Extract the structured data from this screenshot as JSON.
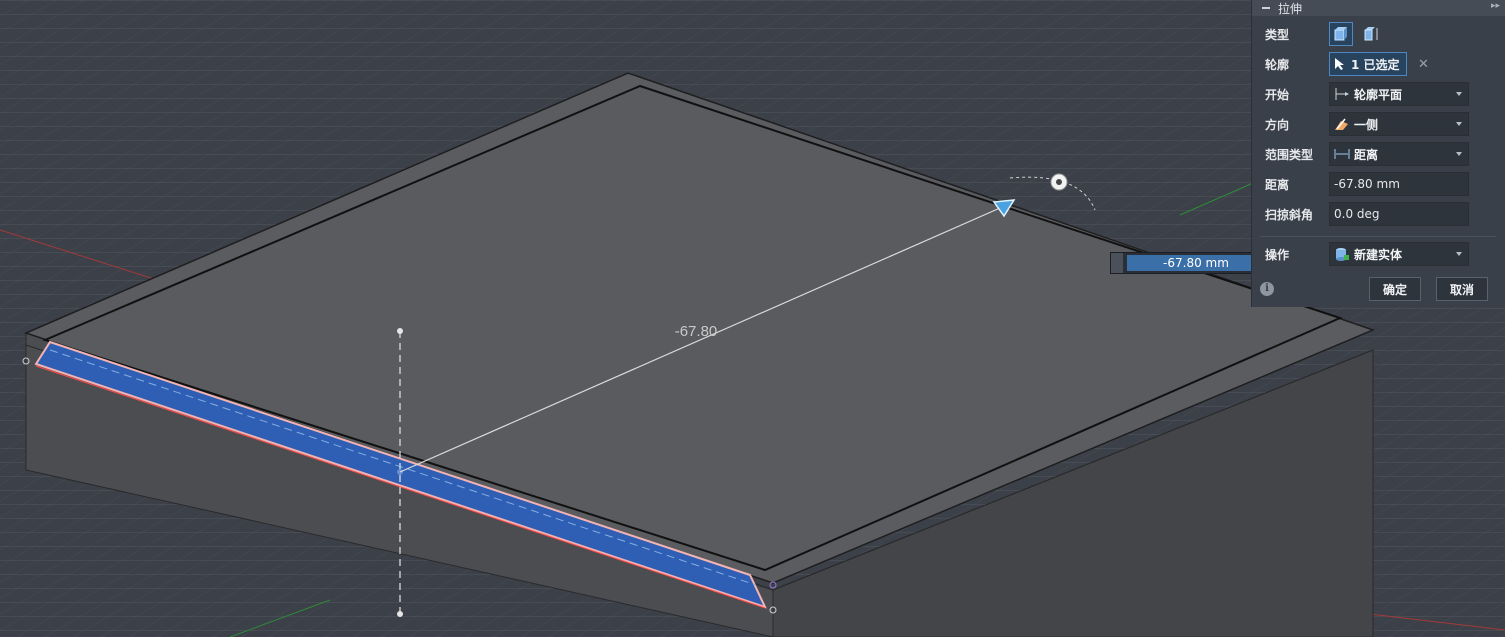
{
  "viewport": {
    "dimension_label": "-67.80"
  },
  "float_input": {
    "value": "-67.80 mm"
  },
  "panel": {
    "title": "拉伸",
    "rows": {
      "type": {
        "label": "类型"
      },
      "profile": {
        "label": "轮廓",
        "value": "1 已选定"
      },
      "start": {
        "label": "开始",
        "value": "轮廓平面"
      },
      "direction": {
        "label": "方向",
        "value": "一侧"
      },
      "extent_type": {
        "label": "范围类型",
        "value": "距离"
      },
      "distance": {
        "label": "距离",
        "value": "-67.80 mm"
      },
      "taper_angle": {
        "label": "扫掠斜角",
        "value": "0.0 deg"
      },
      "operation": {
        "label": "操作",
        "value": "新建实体"
      }
    },
    "ok_label": "确定",
    "cancel_label": "取消"
  },
  "colors": {
    "background": "#3c4048",
    "accent": "#4e89c2",
    "selected_face": "#2f5fb5"
  }
}
